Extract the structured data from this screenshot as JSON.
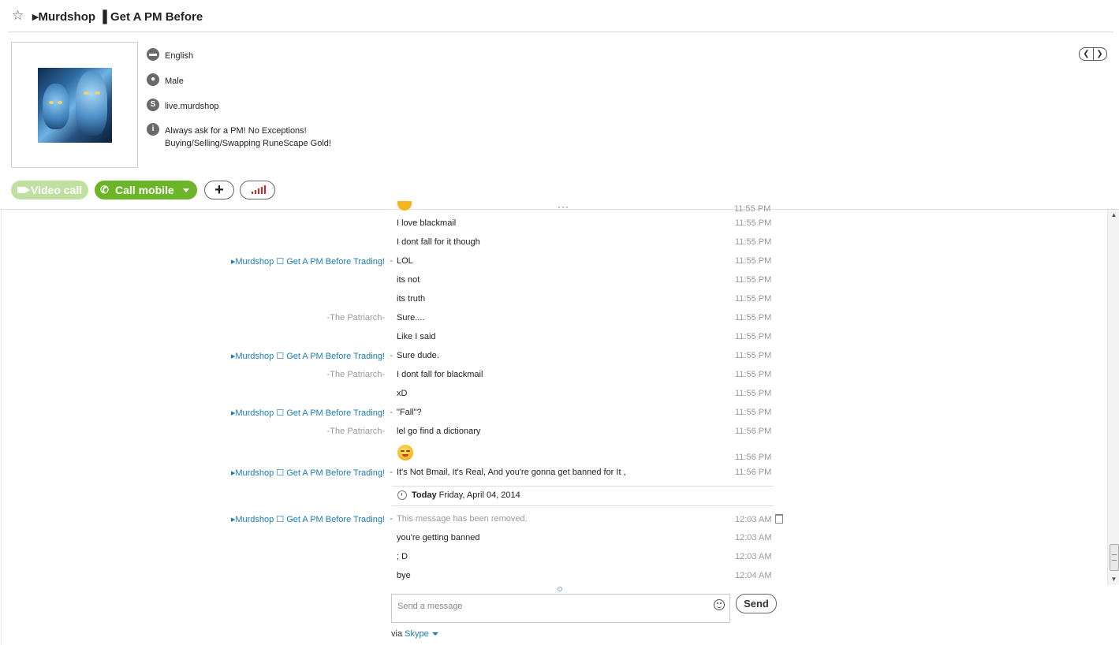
{
  "header": {
    "title": "▸Murdshop ▐ Get A PM Before"
  },
  "profile": {
    "language": "English",
    "gender": "Male",
    "skype_name": "live.murdshop",
    "mood_line1": "Always ask for a PM! No Exceptions!",
    "mood_line2": "Buying/Selling/Swapping RuneScape Gold!"
  },
  "actions": {
    "video_call": "Video call",
    "call_mobile": "Call mobile"
  },
  "chat": {
    "partial_time": "11:55 PM",
    "messages": [
      {
        "name": "",
        "text": "I love blackmail",
        "time": "11:55 PM",
        "who": "other"
      },
      {
        "name": "",
        "text": "I dont fall for it though",
        "time": "11:55 PM",
        "who": "other"
      },
      {
        "name": "▸Murdshop ☐ Get A PM Before Trading!",
        "text": "LOL",
        "time": "11:55 PM",
        "who": "me"
      },
      {
        "name": "",
        "text": "its not",
        "time": "11:55 PM",
        "who": "me"
      },
      {
        "name": "",
        "text": "its truth",
        "time": "11:55 PM",
        "who": "me"
      },
      {
        "name": "-The Patriarch-",
        "text": "Sure....",
        "time": "11:55 PM",
        "who": "other"
      },
      {
        "name": "",
        "text": "Like I said",
        "time": "11:55 PM",
        "who": "other"
      },
      {
        "name": "▸Murdshop ☐ Get A PM Before Trading!",
        "text": "Sure dude.",
        "time": "11:55 PM",
        "who": "me"
      },
      {
        "name": "-The Patriarch-",
        "text": "I dont fall for blackmail",
        "time": "11:55 PM",
        "who": "other"
      },
      {
        "name": "",
        "text": "xD",
        "time": "11:55 PM",
        "who": "other"
      },
      {
        "name": "▸Murdshop ☐ Get A PM Before Trading!",
        "text": "\"Fall\"?",
        "time": "11:55 PM",
        "who": "me"
      },
      {
        "name": "-The Patriarch-",
        "text": "lel go find a dictionary",
        "time": "11:56 PM",
        "who": "other"
      },
      {
        "name": "",
        "text": "",
        "time": "11:56 PM",
        "who": "other",
        "emoji": "smirk-emoji"
      },
      {
        "name": "▸Murdshop ☐ Get A PM Before Trading!",
        "text": "It's Not Bmail, It's Real, And you're gonna get banned for It ,",
        "time": "11:56 PM",
        "who": "me"
      }
    ],
    "day_separator": {
      "bold": "Today",
      "date": "Friday, April 04, 2014"
    },
    "today_messages": [
      {
        "name": "▸Murdshop ☐ Get A PM Before Trading!",
        "text": "This message has been removed.",
        "time": "12:03 AM",
        "who": "me",
        "removed": true
      },
      {
        "name": "",
        "text": "you're getting banned",
        "time": "12:03 AM",
        "who": "me"
      },
      {
        "name": "",
        "text": "; D",
        "time": "12:03 AM",
        "who": "me"
      },
      {
        "name": "",
        "text": "bye",
        "time": "12:04 AM",
        "who": "me"
      }
    ]
  },
  "composer": {
    "placeholder": "Send a message",
    "send_label": "Send",
    "via_prefix": "via",
    "via_link": "Skype"
  }
}
